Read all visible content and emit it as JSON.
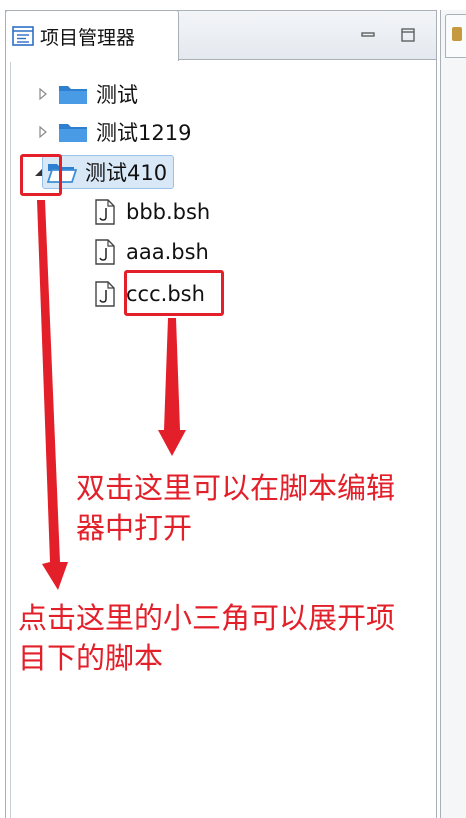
{
  "panel": {
    "title": "项目管理器"
  },
  "tree": {
    "items": [
      {
        "label": "测试",
        "expanded": false
      },
      {
        "label": "测试1219",
        "expanded": false
      },
      {
        "label": "测试410",
        "expanded": true,
        "selected": true
      }
    ],
    "files": [
      {
        "label": "bbb.bsh"
      },
      {
        "label": "aaa.bsh"
      },
      {
        "label": "ccc.bsh"
      }
    ]
  },
  "annotations": {
    "open_editor": {
      "line1": "双击这里可以在脚本编辑",
      "line2": "器中打开"
    },
    "expand_project": {
      "line1": "点击这里的小三角可以展开项",
      "line2": "目下的脚本"
    }
  },
  "colors": {
    "annotation": "#e3202a",
    "folder": "#3d8fd8",
    "selection": "#d9e8f7"
  },
  "icons": {
    "tab": "project-explorer-icon",
    "minimize": "minimize-icon",
    "maximize": "maximize-icon",
    "folder": "folder-icon",
    "file": "script-file-icon"
  }
}
